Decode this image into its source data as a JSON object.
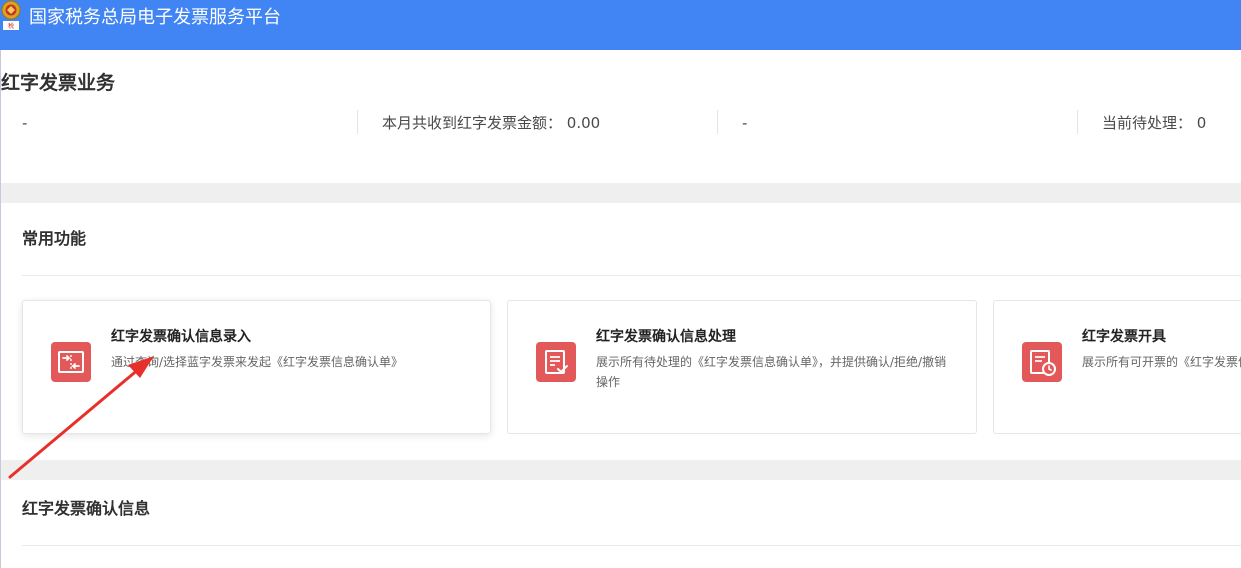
{
  "header": {
    "title": "国家税务总局电子发票服务平台",
    "logo_icon": "tax-emblem-icon",
    "background_color": "#4185f4"
  },
  "page": {
    "title": "红字发票业务"
  },
  "stats": [
    {
      "text": "-"
    },
    {
      "text": "本月共收到红字发票金额：  0.00"
    },
    {
      "text": "-"
    },
    {
      "text": "当前待处理：  0"
    }
  ],
  "common_functions": {
    "title": "常用功能",
    "cards": [
      {
        "title": "红字发票确认信息录入",
        "description": "通过查询/选择蓝字发票来发起《红字发票信息确认单》",
        "icon": "exchange-arrows-icon"
      },
      {
        "title": "红字发票确认信息处理",
        "description": "展示所有待处理的《红字发票信息确认单》，并提供确认/拒绝/撤销操作",
        "icon": "document-check-icon"
      },
      {
        "title": "红字发票开具",
        "description": "展示所有可开票的《红字发票信息确认单》",
        "icon": "document-clock-icon"
      }
    ],
    "icon_color": "#e3595a"
  },
  "confirm_info": {
    "title": "红字发票确认信息"
  },
  "annotation": {
    "color": "#e8302a",
    "icon": "red-arrow-icon"
  }
}
